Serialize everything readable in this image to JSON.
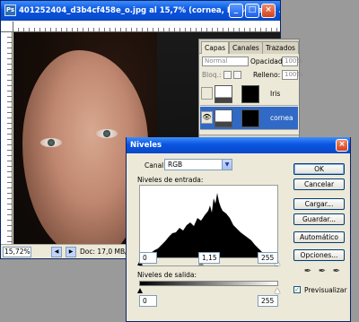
{
  "image_window": {
    "title": "401252404_d3b4cf458e_o.jpg al 15,7% (cornea, Máscara de ...",
    "app_icon": "Ps",
    "minimize_glyph": "_",
    "maximize_glyph": "□",
    "close_glyph": "×",
    "zoom": "15,72%",
    "doc_info": "Doc: 17,0 MB/17,0"
  },
  "layers_panel": {
    "tabs": [
      "Capas",
      "Canales",
      "Trazados"
    ],
    "blend_mode": "Normal",
    "opacity_label": "Opacidad:",
    "opacity_value": "100%",
    "lock_label": "Bloq.:",
    "fill_label": "Relleno:",
    "fill_value": "100%",
    "layers": [
      {
        "name": "Iris",
        "selected": false
      },
      {
        "name": "cornea",
        "selected": true
      }
    ]
  },
  "levels_dialog": {
    "title": "Niveles",
    "close_glyph": "×",
    "channel_label": "Canal:",
    "channel_value": "RGB",
    "input_levels_label": "Niveles de entrada:",
    "input_black": "0",
    "input_gamma": "1,15",
    "input_white": "255",
    "output_levels_label": "Niveles de salida:",
    "output_black": "0",
    "output_white": "255",
    "buttons": {
      "ok": "OK",
      "cancel": "Cancelar",
      "load": "Cargar...",
      "save": "Guardar...",
      "auto": "Automático",
      "options": "Opciones..."
    },
    "preview_label": "Previsualizar",
    "preview_checked": true
  }
}
